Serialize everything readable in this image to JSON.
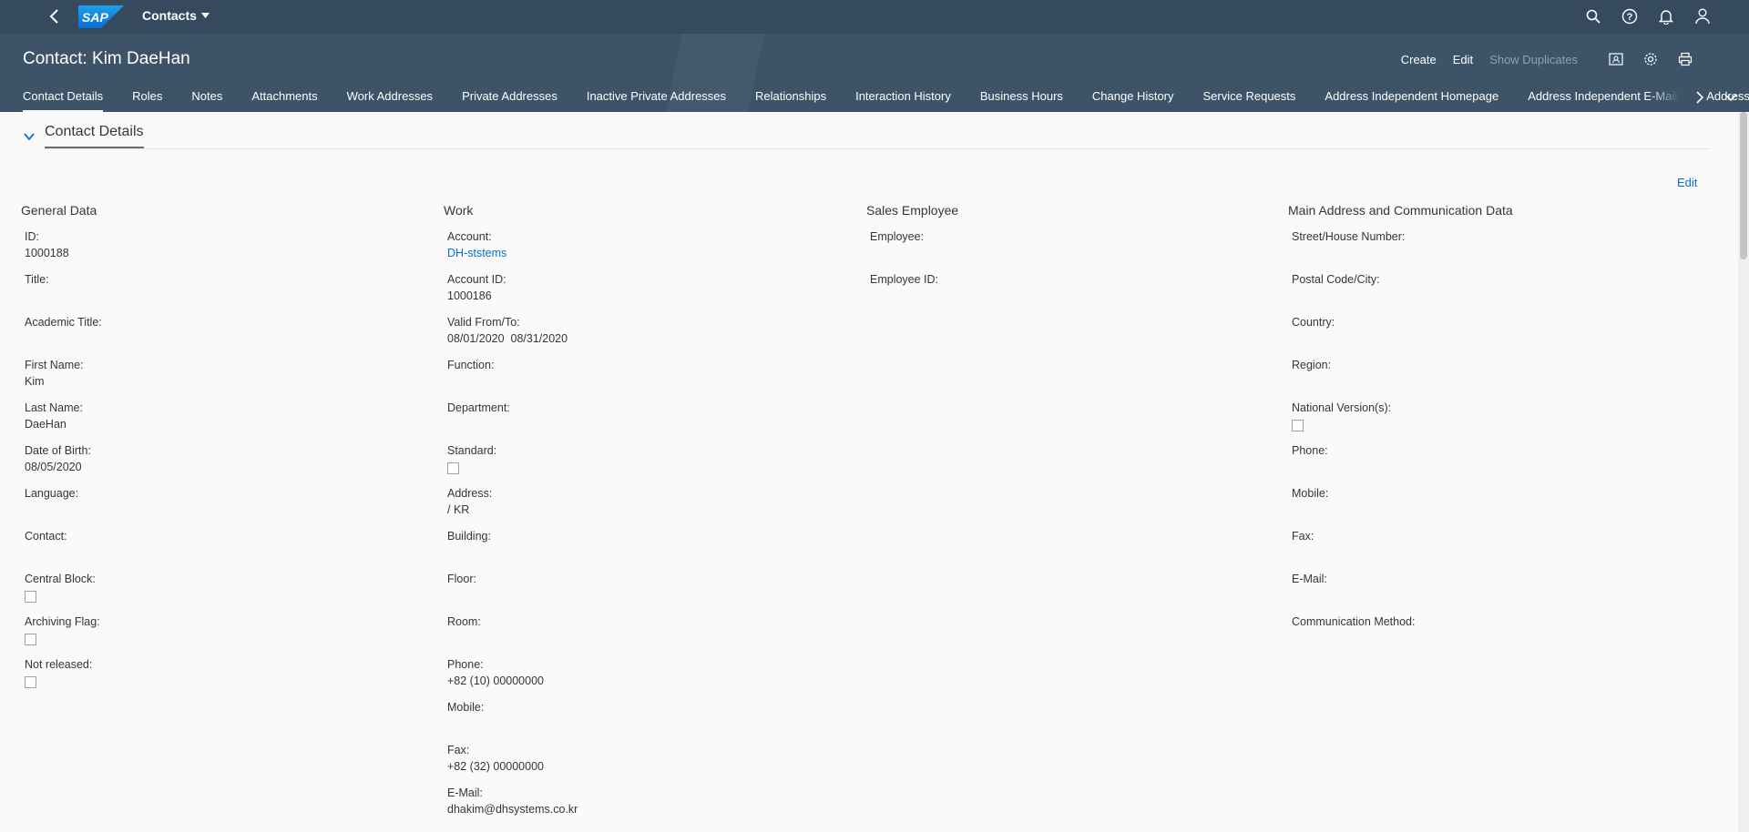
{
  "shell": {
    "app_title": "Contacts"
  },
  "header": {
    "title": "Contact: Kim DaeHan",
    "actions": {
      "create": "Create",
      "edit": "Edit",
      "show_duplicates": "Show Duplicates"
    },
    "tabs": [
      "Contact Details",
      "Roles",
      "Notes",
      "Attachments",
      "Work Addresses",
      "Private Addresses",
      "Inactive Private Addresses",
      "Relationships",
      "Interaction History",
      "Business Hours",
      "Change History",
      "Service Requests",
      "Address Independent Homepage",
      "Address Independent E-Mail",
      "Address"
    ]
  },
  "section": {
    "title": "Contact Details",
    "edit": "Edit"
  },
  "general": {
    "heading": "General Data",
    "id_label": "ID:",
    "id_value": "1000188",
    "title_label": "Title:",
    "academic_label": "Academic Title:",
    "first_label": "First Name:",
    "first_value": "Kim",
    "last_label": "Last Name:",
    "last_value": "DaeHan",
    "dob_label": "Date of Birth:",
    "dob_value": "08/05/2020",
    "language_label": "Language:",
    "contact_label": "Contact:",
    "central_block_label": "Central Block:",
    "archiving_label": "Archiving Flag:",
    "not_released_label": "Not released:"
  },
  "work": {
    "heading": "Work",
    "account_label": "Account:",
    "account_value": "DH-ststems",
    "account_id_label": "Account ID:",
    "account_id_value": "1000186",
    "valid_label": "Valid From/To:",
    "valid_value": "08/01/2020  08/31/2020",
    "function_label": "Function:",
    "department_label": "Department:",
    "standard_label": "Standard:",
    "address_label": "Address:",
    "address_value": "/ KR",
    "building_label": "Building:",
    "floor_label": "Floor:",
    "room_label": "Room:",
    "phone_label": "Phone:",
    "phone_value": "+82 (10) 00000000",
    "mobile_label": "Mobile:",
    "fax_label": "Fax:",
    "fax_value": "+82 (32) 00000000",
    "email_label": "E-Mail:",
    "email_value": "dhakim@dhsystems.co.kr"
  },
  "sales": {
    "heading": "Sales Employee",
    "employee_label": "Employee:",
    "employee_id_label": "Employee ID:"
  },
  "main_address": {
    "heading": "Main Address and Communication Data",
    "street_label": "Street/House Number:",
    "postal_label": "Postal Code/City:",
    "country_label": "Country:",
    "region_label": "Region:",
    "national_label": "National Version(s):",
    "phone_label": "Phone:",
    "mobile_label": "Mobile:",
    "fax_label": "Fax:",
    "email_label": "E-Mail:",
    "comm_method_label": "Communication Method:"
  }
}
